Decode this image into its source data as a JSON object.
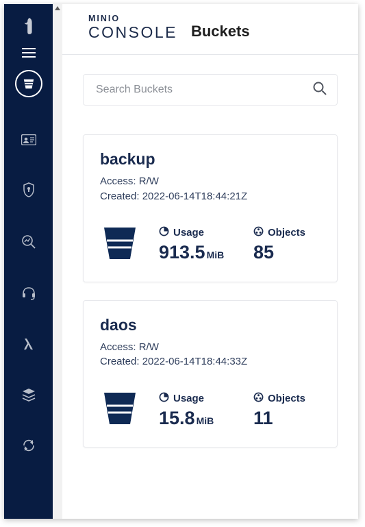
{
  "brand": {
    "top": "MINIO",
    "main": "CONSOLE"
  },
  "page_title": "Buckets",
  "search": {
    "placeholder": "Search Buckets",
    "value": ""
  },
  "labels": {
    "access_prefix": "Access:",
    "created_prefix": "Created:",
    "usage": "Usage",
    "objects": "Objects"
  },
  "buckets": [
    {
      "name": "backup",
      "access": "R/W",
      "created": "2022-06-14T18:44:21Z",
      "usage_value": "913.5",
      "usage_unit": "MiB",
      "objects": "85"
    },
    {
      "name": "daos",
      "access": "R/W",
      "created": "2022-06-14T18:44:33Z",
      "usage_value": "15.8",
      "usage_unit": "MiB",
      "objects": "11"
    }
  ]
}
